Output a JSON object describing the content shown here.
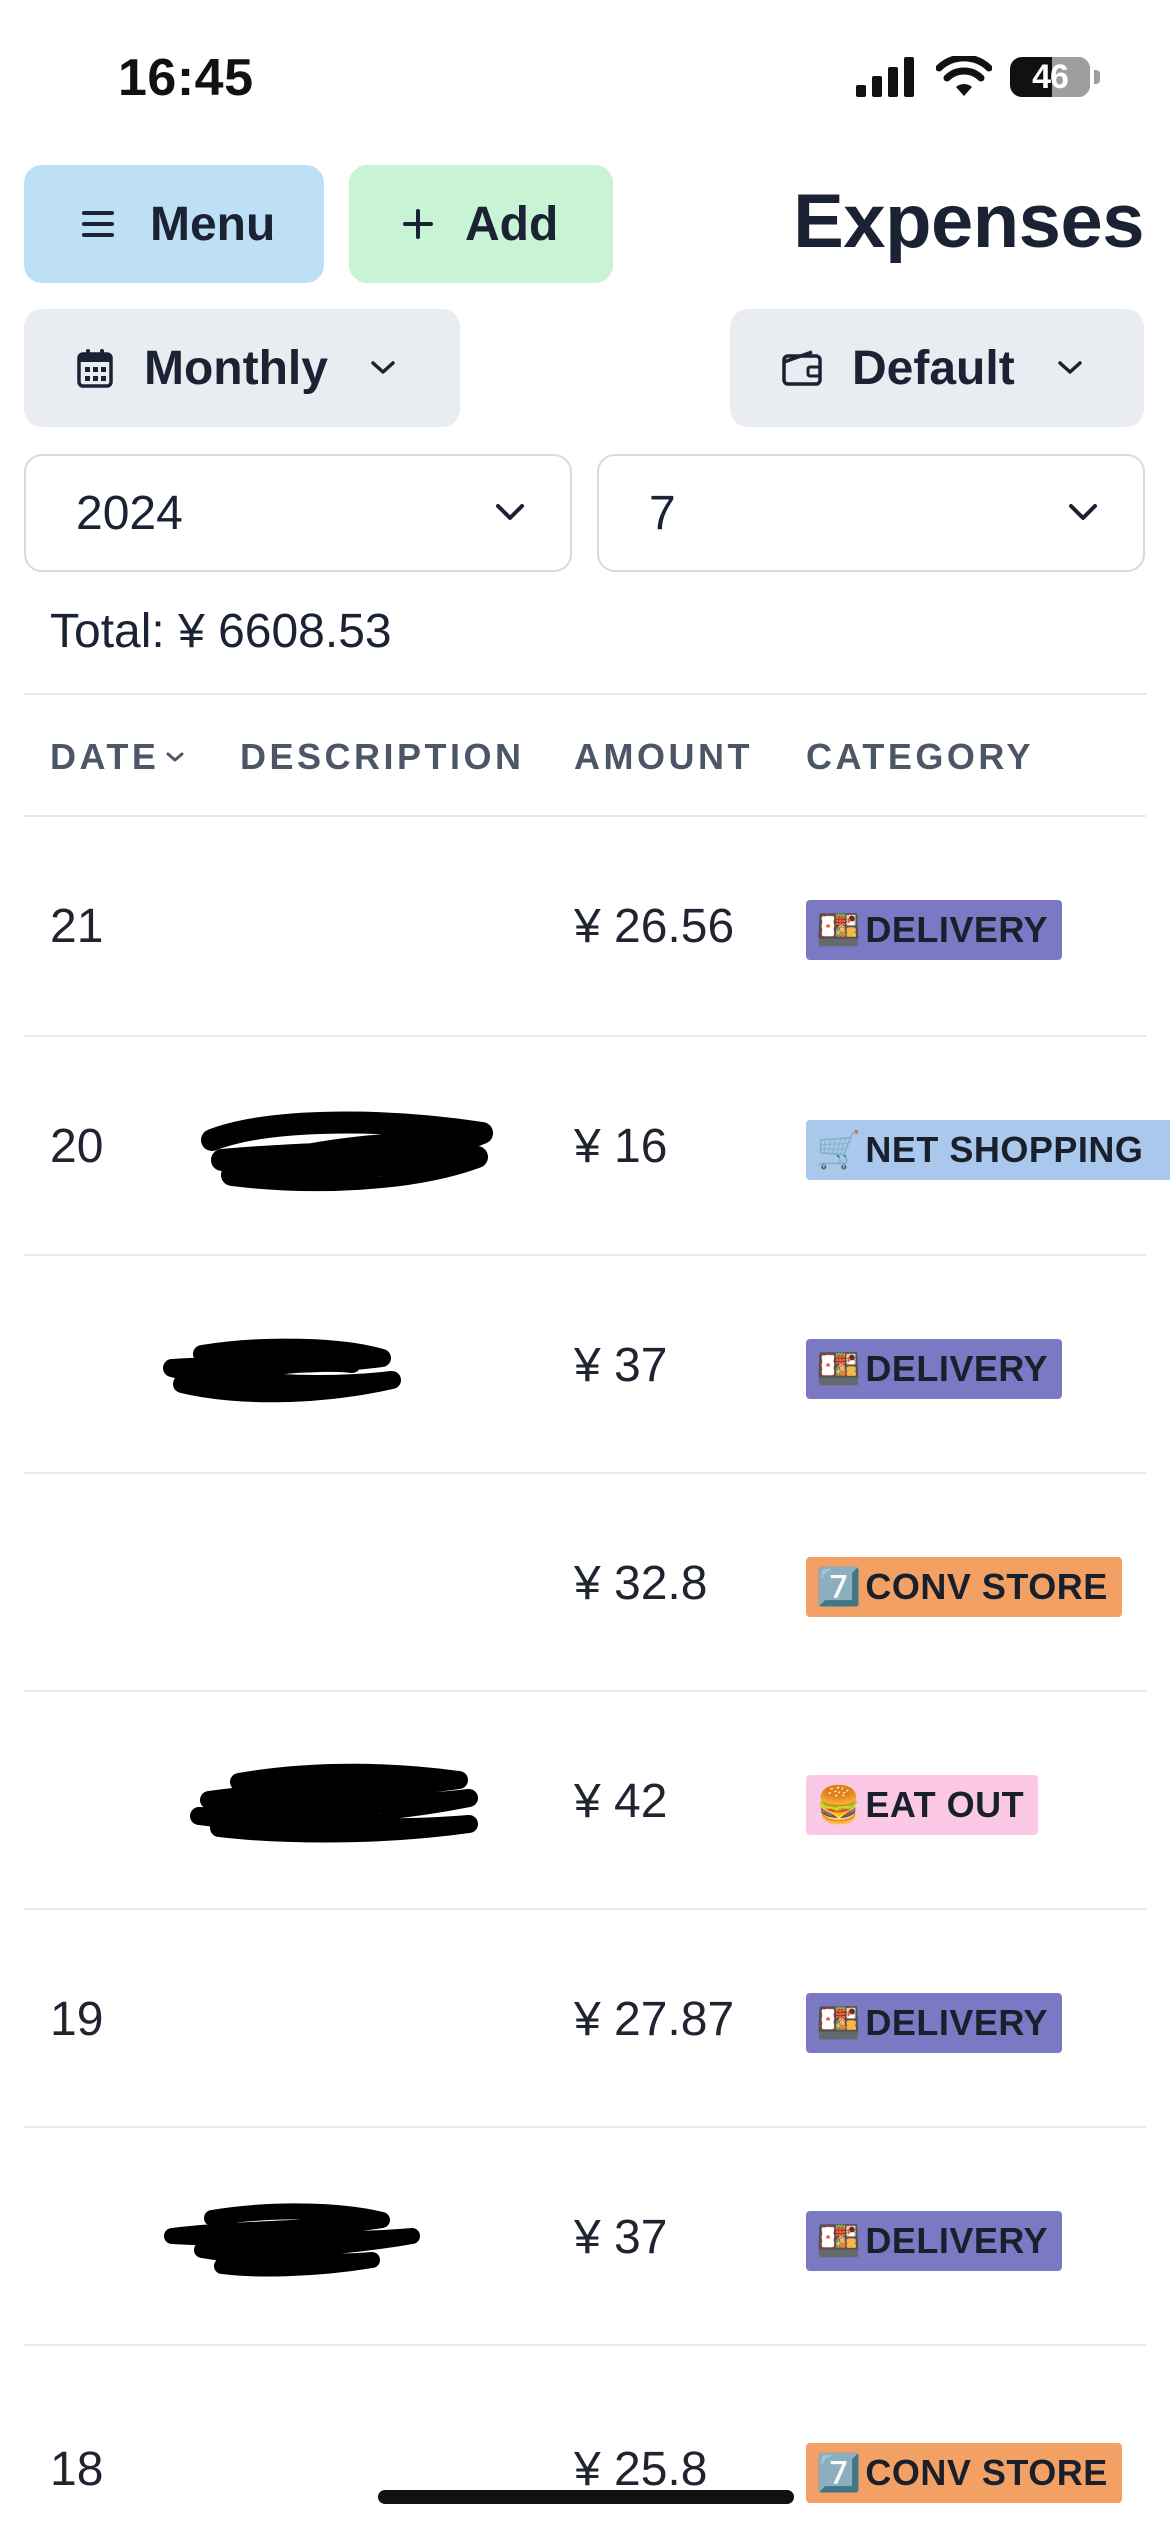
{
  "status": {
    "time": "16:45",
    "battery": "46"
  },
  "toolbar": {
    "menu_label": "Menu",
    "add_label": "Add",
    "title": "Expenses"
  },
  "filters": {
    "period_label": "Monthly",
    "account_label": "Default",
    "year": "2024",
    "month": "7"
  },
  "summary": {
    "total": "Total: ¥ 6608.53"
  },
  "table": {
    "headers": {
      "date": "DATE",
      "description": "DESCRIPTION",
      "amount": "AMOUNT",
      "category": "CATEGORY"
    },
    "rows": [
      {
        "date": "21",
        "amount": "¥ 26.56",
        "category": "DELIVERY",
        "emoji": "🍱"
      },
      {
        "date": "20",
        "amount": "¥ 16",
        "category": "NET SHOPPING",
        "emoji": "🛒"
      },
      {
        "date": "",
        "amount": "¥ 37",
        "category": "DELIVERY",
        "emoji": "🍱"
      },
      {
        "date": "",
        "amount": "¥ 32.8",
        "category": "CONV STORE",
        "emoji": "7️⃣"
      },
      {
        "date": "",
        "amount": "¥ 42",
        "category": "EAT OUT",
        "emoji": "🍔"
      },
      {
        "date": "19",
        "amount": "¥ 27.87",
        "category": "DELIVERY",
        "emoji": "🍱"
      },
      {
        "date": "",
        "amount": "¥ 37",
        "category": "DELIVERY",
        "emoji": "🍱"
      },
      {
        "date": "18",
        "amount": "¥ 25.8",
        "category": "CONV STORE",
        "emoji": "7️⃣"
      }
    ]
  },
  "colors": {
    "menu_bg": "#bde0f6",
    "add_bg": "#c8f3d4",
    "chip_bg": "#e9edf2",
    "delivery": "#7b78c4",
    "net_shopping": "#a9c8ec",
    "conv_store": "#f3a064",
    "eat_out": "#fbc9e6"
  }
}
